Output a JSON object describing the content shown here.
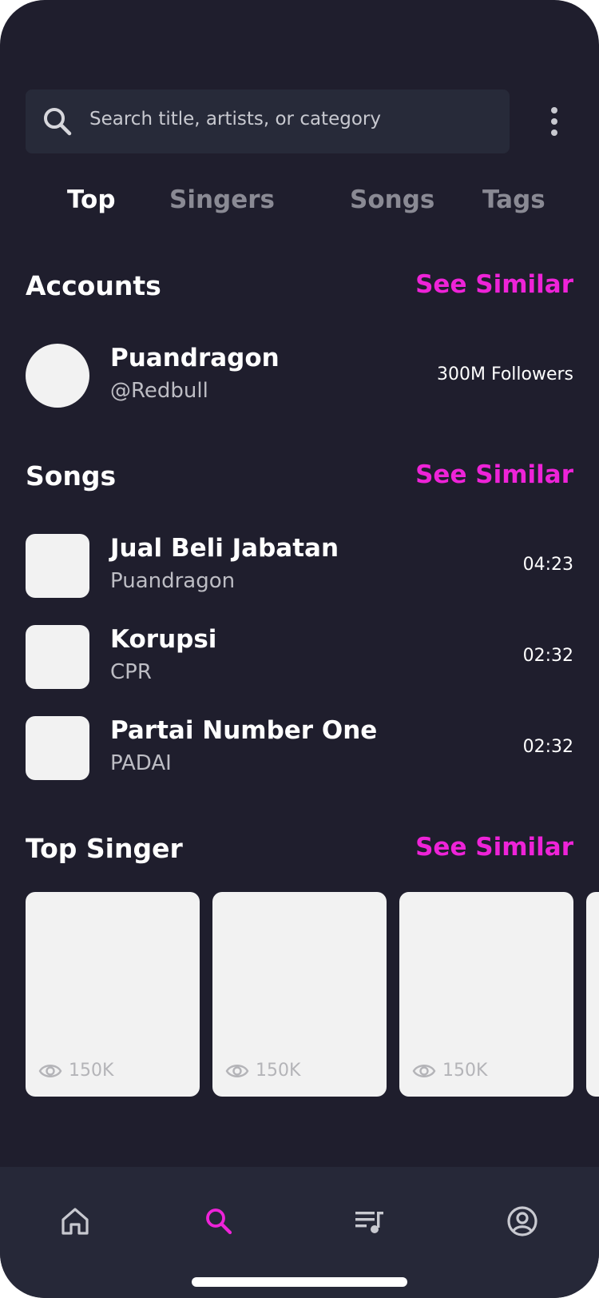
{
  "search": {
    "placeholder": "Search title, artists, or category"
  },
  "tabs": [
    {
      "label": "Top",
      "active": true
    },
    {
      "label": "Singers",
      "active": false
    },
    {
      "label": "Songs",
      "active": false
    },
    {
      "label": "Tags",
      "active": false
    }
  ],
  "accounts": {
    "title": "Accounts",
    "see_label": "See Similar",
    "item": {
      "name": "Puandragon",
      "handle": "@Redbull",
      "followers": "300M Followers"
    }
  },
  "songs": {
    "title": "Songs",
    "see_label": "See Similar",
    "items": [
      {
        "title": "Jual Beli Jabatan",
        "artist": "Puandragon",
        "duration": "04:23"
      },
      {
        "title": "Korupsi",
        "artist": "CPR",
        "duration": "02:32"
      },
      {
        "title": "Partai Number One",
        "artist": "PADAI",
        "duration": "02:32"
      }
    ]
  },
  "top_singer": {
    "title": "Top Singer",
    "see_label": "See Similar",
    "cards": [
      {
        "views": "150K"
      },
      {
        "views": "150K"
      },
      {
        "views": "150K"
      }
    ]
  },
  "nav": {
    "icons": [
      "home-icon",
      "search-icon",
      "playlist-icon",
      "profile-icon"
    ],
    "active": "search"
  },
  "colors": {
    "background": "#1f1e2d",
    "accent": "#ee23d8",
    "surface": "#272a39"
  }
}
